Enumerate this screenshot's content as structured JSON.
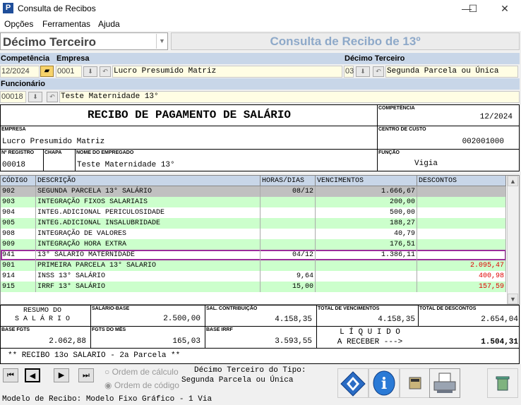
{
  "window": {
    "title": "Consulta de Recibos",
    "minimize": "—",
    "maximize": "☐",
    "close": "✕"
  },
  "menu": [
    "Opções",
    "Ferramentas",
    "Ajuda"
  ],
  "type_select": {
    "value": "Décimo Terceiro"
  },
  "headline": "Consulta de Recibo de 13º",
  "filters": {
    "competencia_label": "Competência",
    "competencia": "12/2024",
    "empresa_label": "Empresa",
    "empresa_code": "0001",
    "empresa_name": "Lucro Presumido Matriz",
    "decimo_label": "Décimo Terceiro",
    "decimo_code": "03",
    "decimo_name": "Segunda Parcela ou Única",
    "funcionario_label": "Funcionário",
    "funcionario_code": "00018",
    "funcionario_name": "Teste Maternidade 13°"
  },
  "recibo": {
    "title": "RECIBO DE PAGAMENTO DE SALÁRIO",
    "competencia_cap": "COMPETÊNCIA",
    "competencia": "12/2024",
    "empresa_cap": "EMPRESA",
    "empresa": "Lucro Presumido Matriz",
    "centro_cap": "CENTRO DE CUSTO",
    "centro": "002001000",
    "registro_cap": "Nº REGISTRO",
    "registro": "00018",
    "chapa_cap": "CHAPA",
    "nome_cap": "NOME DO EMPREGADO",
    "nome": "Teste Maternidade 13°",
    "funcao_cap": "FUNÇÃO",
    "funcao": "Vigia"
  },
  "grid": {
    "headers": [
      "CÓDIGO",
      "DESCRIÇÃO",
      "HORAS/DIAS",
      "VENCIMENTOS",
      "DESCONTOS"
    ],
    "rows": [
      {
        "cod": "902",
        "desc": "SEGUNDA PARCELA 13° SALÁRIO",
        "horas": "08/12",
        "venc": "1.666,67",
        "desc_val": "",
        "bg": "#c0c0c0"
      },
      {
        "cod": "903",
        "desc": "INTEGRAÇÃO FIXOS SALARIAIS",
        "horas": "",
        "venc": "200,00",
        "desc_val": "",
        "bg": "#ccffcc"
      },
      {
        "cod": "904",
        "desc": "INTEG.ADICIONAL PERICULOSIDADE",
        "horas": "",
        "venc": "500,00",
        "desc_val": "",
        "bg": "#ffffff"
      },
      {
        "cod": "905",
        "desc": "INTEG.ADICIONAL INSALUBRIDADE",
        "horas": "",
        "venc": "188,27",
        "desc_val": "",
        "bg": "#ccffcc"
      },
      {
        "cod": "908",
        "desc": "INTEGRAÇÃO DE VALORES",
        "horas": "",
        "venc": "40,79",
        "desc_val": "",
        "bg": "#ffffff"
      },
      {
        "cod": "909",
        "desc": "INTEGRAÇÃO HORA EXTRA",
        "horas": "",
        "venc": "176,51",
        "desc_val": "",
        "bg": "#ccffcc"
      },
      {
        "cod": "941",
        "desc": "13° SALARIO MATERNIDADE",
        "horas": "04/12",
        "venc": "1.386,11",
        "desc_val": "",
        "bg": "#ffffff",
        "selected": true
      },
      {
        "cod": "901",
        "desc": "PRIMEIRA PARCELA 13° SALARIO",
        "horas": "",
        "venc": "",
        "desc_val": "2.095,47",
        "bg": "#ccffcc"
      },
      {
        "cod": "914",
        "desc": "INSS 13° SALÁRIO",
        "horas": "9,64",
        "venc": "",
        "desc_val": "400,98",
        "bg": "#ffffff"
      },
      {
        "cod": "915",
        "desc": "IRRF 13° SALÁRIO",
        "horas": "15,00",
        "venc": "",
        "desc_val": "157,59",
        "bg": "#ccffcc"
      }
    ]
  },
  "totals": {
    "resumo1": "RESUMO DO",
    "resumo2": "S A L Á R I O",
    "salario_base_cap": "SALÁRIO-BASE",
    "salario_base": "2.500,00",
    "sal_contrib_cap": "SAL. CONTRIBUIÇÃO",
    "sal_contrib": "4.158,35",
    "total_venc_cap": "TOTAL DE VENCIMENTOS",
    "total_venc": "4.158,35",
    "total_desc_cap": "TOTAL DE DESCONTOS",
    "total_desc": "2.654,04",
    "base_fgts_cap": "BASE FGTS",
    "base_fgts": "2.062,88",
    "fgts_mes_cap": "FGTS DO MÊS",
    "fgts_mes": "165,03",
    "base_irrf_cap": "BASE IRRF",
    "base_irrf": "3.593,55",
    "liquido1": "L Í Q U I D O",
    "liquido2": "A RECEBER --->",
    "liquido": "1.504,31"
  },
  "note": "** RECIBO 13o SALARIO - 2a Parcela **",
  "order": {
    "option1": "Ordem de cálculo",
    "option2": "Ordem de código"
  },
  "tipo": {
    "line1": "Décimo Terceiro do Tipo:",
    "line2": "Segunda Parcela ou Única"
  },
  "status": "Modelo de Recibo: Modelo Fixo Gráfico - 1 Via",
  "colors": {
    "accent": "#1f4e9a",
    "header": "#c8d6e8",
    "field": "#fffde4",
    "green_row": "#ccffcc",
    "discount": "#e00000",
    "selected_border": "#9b2d9b"
  }
}
